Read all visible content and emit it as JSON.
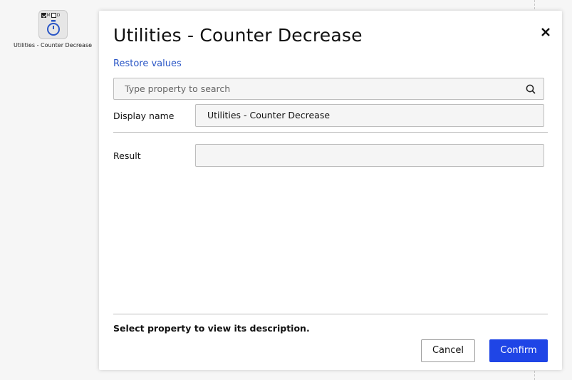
{
  "node": {
    "label": "Utilities - Counter Decrease",
    "flags": {
      "m": "M",
      "d": "D"
    },
    "icon": "stopwatch-icon"
  },
  "dialog": {
    "title": "Utilities - Counter Decrease",
    "close_icon": "close-icon",
    "restore_label": "Restore values",
    "search": {
      "placeholder": "Type property to search",
      "icon": "search-icon"
    },
    "properties": [
      {
        "label": "Display name",
        "value": "Utilities - Counter Decrease"
      },
      {
        "label": "Result",
        "value": ""
      }
    ],
    "description": "Select property to view its description.",
    "cancel_label": "Cancel",
    "confirm_label": "Confirm"
  },
  "colors": {
    "accent": "#1f45e6",
    "link": "#2a56c6",
    "icon_blue": "#2a56c6"
  }
}
